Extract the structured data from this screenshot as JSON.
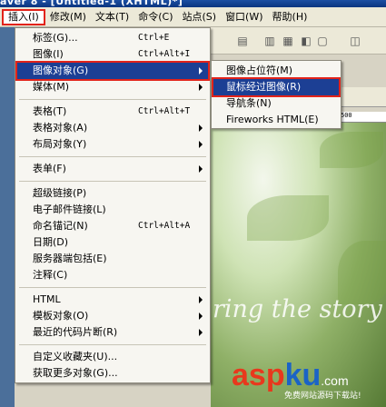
{
  "window": {
    "title": "aver 8 - [Untitled-1 (XHTML)*]"
  },
  "menubar": {
    "items": [
      {
        "label": "插入(I)",
        "active": true
      },
      {
        "label": "修改(M)"
      },
      {
        "label": "文本(T)"
      },
      {
        "label": "命令(C)"
      },
      {
        "label": "站点(S)"
      },
      {
        "label": "窗口(W)"
      },
      {
        "label": "帮助(H)"
      }
    ]
  },
  "insert_menu": {
    "items": [
      {
        "label": "标签(G)...",
        "shortcut": "Ctrl+E"
      },
      {
        "label": "图像(I)",
        "shortcut": "Ctrl+Alt+I"
      },
      {
        "label": "图像对象(G)",
        "submenu": true,
        "highlighted": true
      },
      {
        "label": "媒体(M)",
        "submenu": true
      },
      {
        "sep": true
      },
      {
        "label": "表格(T)",
        "shortcut": "Ctrl+Alt+T"
      },
      {
        "label": "表格对象(A)",
        "submenu": true
      },
      {
        "label": "布局对象(Y)",
        "submenu": true
      },
      {
        "sep": true
      },
      {
        "label": "表单(F)",
        "submenu": true
      },
      {
        "sep": true
      },
      {
        "label": "超级链接(P)"
      },
      {
        "label": "电子邮件链接(L)"
      },
      {
        "label": "命名锚记(N)",
        "shortcut": "Ctrl+Alt+A"
      },
      {
        "label": "日期(D)"
      },
      {
        "label": "服务器端包括(E)"
      },
      {
        "label": "注释(C)"
      },
      {
        "sep": true
      },
      {
        "label": "HTML",
        "submenu": true
      },
      {
        "label": "模板对象(O)",
        "submenu": true
      },
      {
        "label": "最近的代码片断(R)",
        "submenu": true
      },
      {
        "sep": true
      },
      {
        "label": "自定义收藏夹(U)..."
      },
      {
        "label": "获取更多对象(G)..."
      }
    ]
  },
  "image_objects_submenu": {
    "items": [
      {
        "label": "图像占位符(M)"
      },
      {
        "label": "鼠标经过图像(R)",
        "highlighted": true
      },
      {
        "label": "导航条(N)"
      },
      {
        "label": "Fireworks HTML(E)"
      }
    ]
  },
  "ruler": {
    "mark": "500"
  },
  "canvas": {
    "banner_text": "ring the story"
  },
  "watermark": {
    "brand_a": "asp",
    "brand_b": "ku",
    "suffix": ".com",
    "tagline": "免费网站源码下载站!"
  },
  "colors": {
    "menu_highlight": "#1c3f94",
    "callout_red": "#e2231a",
    "menu_bg": "#f7f6f1"
  }
}
